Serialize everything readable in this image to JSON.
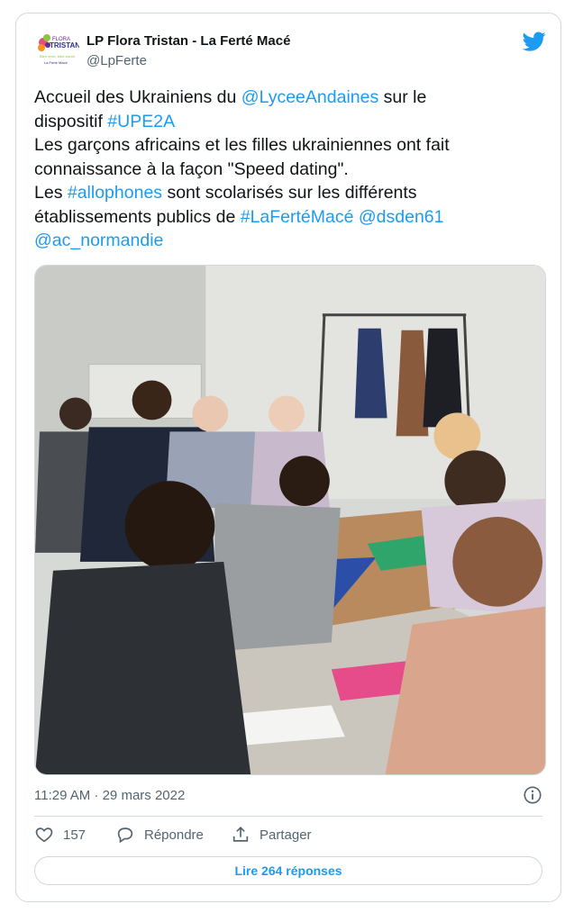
{
  "account": {
    "name": "LP Flora Tristan - La Ferté Macé",
    "handle": "@LpFerte",
    "avatar_icon": "school-logo-icon",
    "avatar_logo_text": [
      "FLORA",
      "TRISTAN",
      "Bien vivre, bien savoir",
      "La Ferté Macé"
    ]
  },
  "brand": {
    "icon": "twitter-bird-icon",
    "color": "#1d9bf0"
  },
  "tweet": {
    "line1_a": "Accueil des Ukrainiens du ",
    "mention_lycee": "@LyceeAndaines",
    "line1_b": " sur le",
    "line2_a": "dispositif ",
    "hashtag_upe2a": "#UPE2A",
    "line3": "Les garçons africains et les filles ukrainiennes ont fait",
    "line4": "connaissance à la façon \"Speed dating\".",
    "line5_a": "Les ",
    "hashtag_allophones": "#allophones",
    "line5_b": " sont scolarisés sur les différents",
    "line6_a": "établissements publics de ",
    "hashtag_lafertemace": "#LaFertéMacé",
    "line6_b": " ",
    "mention_dsden": "@dsden61",
    "mention_normandie": "@ac_normandie"
  },
  "photo": {
    "subject": "classroom-photo"
  },
  "meta": {
    "timestamp": "11:29 AM · 29 mars 2022",
    "info_icon": "info-icon"
  },
  "actions": {
    "like_icon": "heart-icon",
    "like_count": "157",
    "reply_icon": "reply-bubble-icon",
    "reply_label": "Répondre",
    "share_icon": "share-upload-icon",
    "share_label": "Partager"
  },
  "replies_button": {
    "label": "Lire 264 réponses"
  },
  "colors": {
    "link": "#1d9bf0",
    "secondary_text": "#536471",
    "border": "#cfd9de"
  }
}
